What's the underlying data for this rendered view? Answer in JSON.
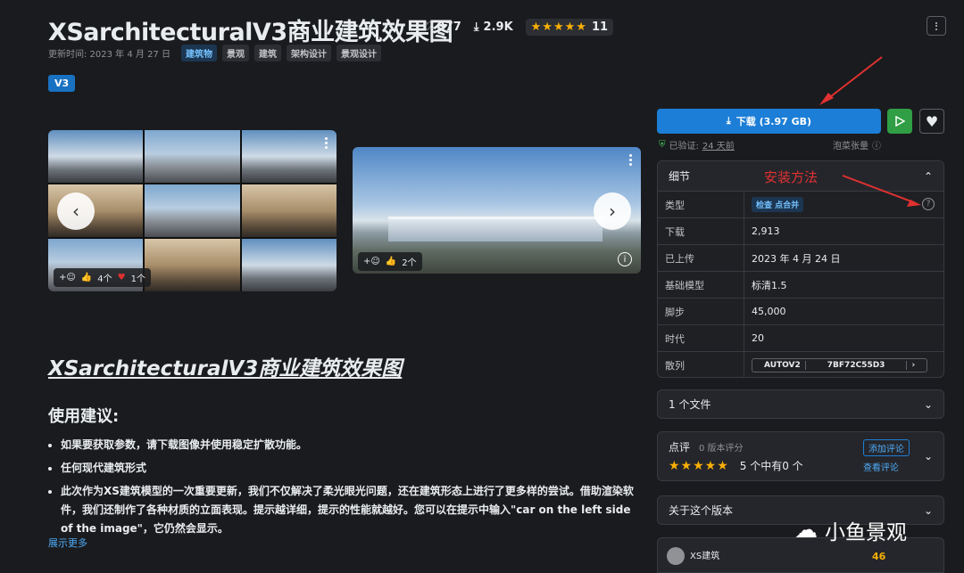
{
  "header": {
    "title": "XSarchitecturalV3商业建筑效果图",
    "likes": "377",
    "downloads": "2.9K",
    "rating_count": "11",
    "updated": "更新时间: 2023 年 4 月 27 日",
    "tags": [
      "建筑物",
      "景观",
      "建筑",
      "架构设计",
      "景观设计"
    ],
    "version_badge": "V3"
  },
  "gallery": {
    "left_reactions": {
      "like": "4个",
      "heart": "1个"
    },
    "right_reactions": {
      "like": "2个"
    }
  },
  "content": {
    "heading": "XSarchitecturalV3商业建筑效果图",
    "subheading": "使用建议:",
    "bullets": [
      "如果要获取参数，请下载图像并使用稳定扩散功能。",
      "任何现代建筑形式",
      "此次作为XS建筑模型的一次重要更新，我们不仅解决了柔光眼光问题，还在建筑形态上进行了更多样的尝试。借助渲染软件，我们还制作了各种材质的立面表现。提示越详细，提示的性能就越好。您可以在提示中输入\"car on the left side of the image\"，它仍然会显示。"
    ],
    "show_more": "展示更多"
  },
  "sidebar": {
    "download_label": "下载 (3.97 GB)",
    "verified_label": "已验证:",
    "verified_time": "24 天前",
    "bubble_label": "泡菜张量",
    "annotation": "安装方法",
    "details_title": "细节",
    "details": [
      {
        "key": "类型",
        "value": "检查 点合并"
      },
      {
        "key": "下载",
        "value": "2,913"
      },
      {
        "key": "已上传",
        "value": "2023 年 4 月 24 日"
      },
      {
        "key": "基础模型",
        "value": "标清1.5"
      },
      {
        "key": "脚步",
        "value": "45,000"
      },
      {
        "key": "时代",
        "value": "20"
      },
      {
        "key": "散列",
        "value": ""
      }
    ],
    "hash": {
      "algo": "AUTOV2",
      "value": "7BF72C55D3"
    },
    "files": "1 个文件",
    "reviews_title": "点评",
    "reviews_sub": "0 版本评分",
    "reviews_summary": "5 个中有0 个",
    "add_review": "添加评论",
    "view_reviews": "查看评论",
    "about": "关于这个版本",
    "creator": "XS建筑",
    "creator_count": "46"
  },
  "watermark": "小鱼景观",
  "colors": {
    "accent": "#1c7ed6",
    "star": "#fab005",
    "annotation": "#e03131"
  }
}
